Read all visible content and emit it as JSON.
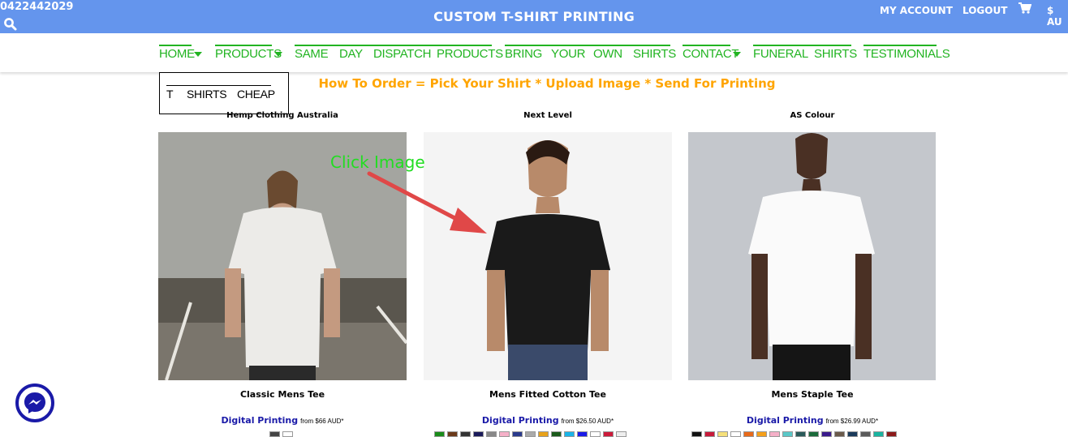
{
  "header": {
    "phone": "0422442029",
    "title": "CUSTOM T-SHIRT PRINTING",
    "my_account": "MY ACCOUNT",
    "logout": "LOGOUT",
    "currency": "$ AU",
    "colors": {
      "bar": "#6495ed",
      "nav_green": "#22b422",
      "howto_orange": "#ffa500"
    }
  },
  "nav": {
    "home": "HOME",
    "products": "PRODUCTS",
    "same": "SAME",
    "day": "DAY",
    "dispatch": "DISPATCH",
    "products2": "PRODUCTS",
    "bring": "BRING",
    "your": "YOUR",
    "own": "OWN",
    "shirts": "SHIRTS",
    "contact": "CONTACT",
    "funeral": "FUNERAL",
    "shirts2": "SHIRTS",
    "testimonials": "TESTIMONIALS"
  },
  "logo_box": {
    "t": "T",
    "shirts": "SHIRTS",
    "cheap": "CHEAP"
  },
  "howto": "How To Order = Pick Your Shirt * Upload Image * Send For Printing",
  "annotation": "Click Image",
  "products": [
    {
      "brand": "Hemp Clothing Australia",
      "name": "Classic Mens Tee",
      "method": "Digital Printing",
      "price": "from $66 AUD*",
      "swatches": [
        "#444444",
        "#ffffff"
      ]
    },
    {
      "brand": "Next Level",
      "name": "Mens Fitted Cotton Tee",
      "method": "Digital Printing",
      "price": "from $26.50 AUD*",
      "swatches": [
        "#1a8c1a",
        "#6b3a1a",
        "#333333",
        "#1a1a5a",
        "#888888",
        "#f5b0c8",
        "#2a3a8c",
        "#aaaaaa",
        "#e8a21a",
        "#1a5a1a",
        "#1ab4e8",
        "#1a1ae8",
        "#ffffff",
        "#cc1a3a",
        "#eeeeee"
      ]
    },
    {
      "brand": "AS Colour",
      "name": "Mens Staple Tee",
      "method": "Digital Printing",
      "price": "from $26.99 AUD*",
      "swatches": [
        "#111111",
        "#c81a3a",
        "#f5e07a",
        "#ffffff",
        "#e86a1a",
        "#f5a01a",
        "#f5b0c8",
        "#5ac8c8",
        "#2a5a5a",
        "#1a6a3a",
        "#3a1a8c",
        "#6a5a4a",
        "#1a3a5a",
        "#5a5a5a",
        "#1ab4a0",
        "#8c1a1a"
      ]
    }
  ]
}
